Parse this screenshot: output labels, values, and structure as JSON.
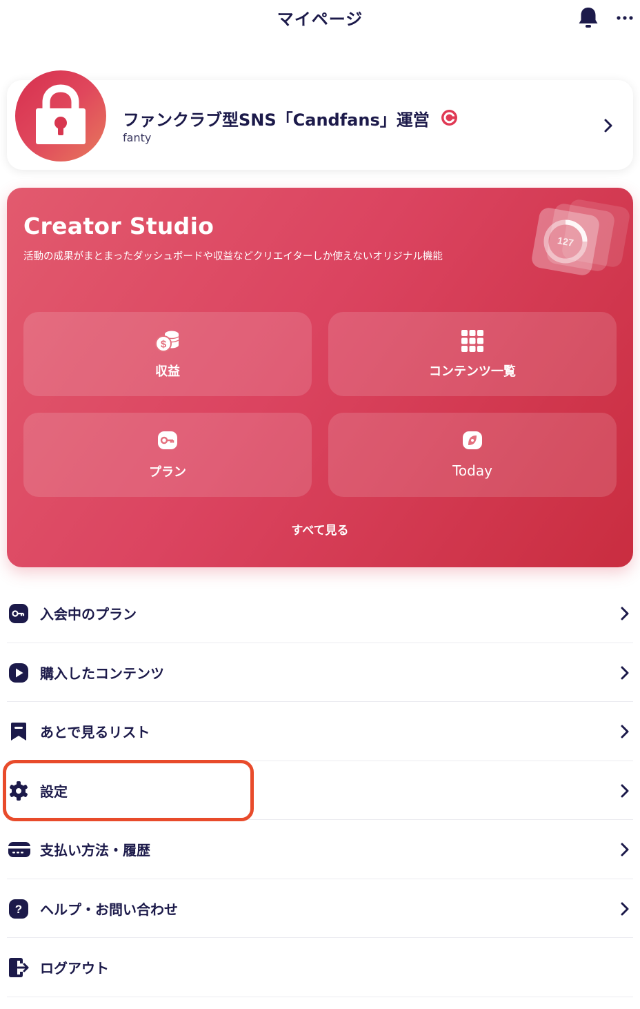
{
  "header": {
    "title": "マイページ",
    "bell_icon": "bell-icon",
    "more_icon": "more-horizontal-icon"
  },
  "profile": {
    "name": "ファンクラブ型SNS「Candfans」運営",
    "badge_letter": "C",
    "id": "fanty",
    "avatar_icon": "padlock-icon"
  },
  "studio": {
    "title": "Creator Studio",
    "description": "活動の成果がまとまったダッシュボードや収益などクリエイターしか使えないオリジナル機能",
    "art_number": "127",
    "tiles": [
      {
        "label": "収益",
        "icon": "coins-dollar-icon"
      },
      {
        "label": "コンテンツ一覧",
        "icon": "grid-icon"
      },
      {
        "label": "プラン",
        "icon": "key-icon"
      },
      {
        "label": "Today",
        "icon": "compass-icon"
      }
    ],
    "see_all": "すべて見る"
  },
  "menu": {
    "items": [
      {
        "label": "入会中のプラン",
        "icon": "key-icon"
      },
      {
        "label": "購入したコンテンツ",
        "icon": "play-icon"
      },
      {
        "label": "あとで見るリスト",
        "icon": "bookmark-icon"
      },
      {
        "label": "設定",
        "icon": "gear-icon"
      },
      {
        "label": "支払い方法・履歴",
        "icon": "credit-card-icon"
      },
      {
        "label": "ヘルプ・お問い合わせ",
        "icon": "help-icon"
      },
      {
        "label": "ログアウト",
        "icon": "logout-icon"
      }
    ]
  },
  "colors": {
    "navy": "#1c1a4a",
    "brand_red": "#db4460",
    "highlight": "#e84b2b"
  }
}
